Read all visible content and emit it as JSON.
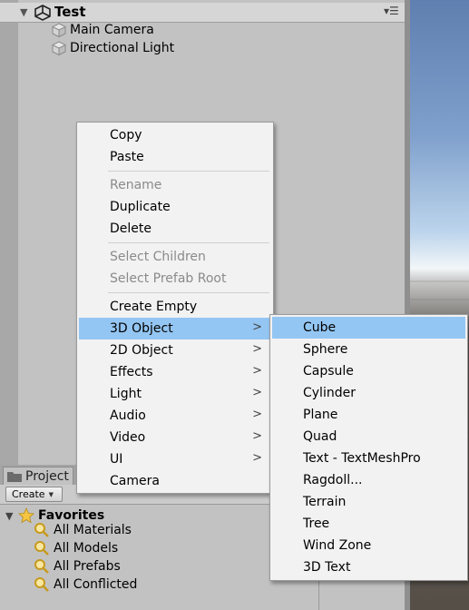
{
  "hierarchy": {
    "scene_name": "Test",
    "items": [
      {
        "label": "Main Camera",
        "icon": "gameobject-icon"
      },
      {
        "label": "Directional Light",
        "icon": "gameobject-icon"
      }
    ]
  },
  "project": {
    "tab_label": "Project",
    "create_label": "Create",
    "favorites_label": "Favorites",
    "searches": [
      {
        "label": "All Materials"
      },
      {
        "label": "All Models"
      },
      {
        "label": "All Prefabs"
      },
      {
        "label": "All Conflicted"
      }
    ]
  },
  "context_menu": {
    "items": [
      {
        "label": "Copy",
        "enabled": true
      },
      {
        "label": "Paste",
        "enabled": true
      },
      {
        "label": "Rename",
        "enabled": false
      },
      {
        "label": "Duplicate",
        "enabled": true
      },
      {
        "label": "Delete",
        "enabled": true
      },
      {
        "label": "Select Children",
        "enabled": false
      },
      {
        "label": "Select Prefab Root",
        "enabled": false
      },
      {
        "label": "Create Empty",
        "enabled": true
      },
      {
        "label": "3D Object",
        "enabled": true,
        "submenu": true,
        "highlighted": true
      },
      {
        "label": "2D Object",
        "enabled": true,
        "submenu": true
      },
      {
        "label": "Effects",
        "enabled": true,
        "submenu": true
      },
      {
        "label": "Light",
        "enabled": true,
        "submenu": true
      },
      {
        "label": "Audio",
        "enabled": true,
        "submenu": true
      },
      {
        "label": "Video",
        "enabled": true,
        "submenu": true
      },
      {
        "label": "UI",
        "enabled": true,
        "submenu": true
      },
      {
        "label": "Camera",
        "enabled": true
      }
    ]
  },
  "submenu_3d": {
    "items": [
      {
        "label": "Cube",
        "highlighted": true
      },
      {
        "label": "Sphere"
      },
      {
        "label": "Capsule"
      },
      {
        "label": "Cylinder"
      },
      {
        "label": "Plane"
      },
      {
        "label": "Quad"
      },
      {
        "label": "Text - TextMeshPro"
      },
      {
        "label": "Ragdoll..."
      },
      {
        "label": "Terrain"
      },
      {
        "label": "Tree"
      },
      {
        "label": "Wind Zone"
      },
      {
        "label": "3D Text"
      }
    ]
  },
  "colors": {
    "panel_bg": "#c2c2c2",
    "menu_bg": "#f2f2f2",
    "highlight": "#94c6f3",
    "disabled_text": "#8a8a8a"
  }
}
